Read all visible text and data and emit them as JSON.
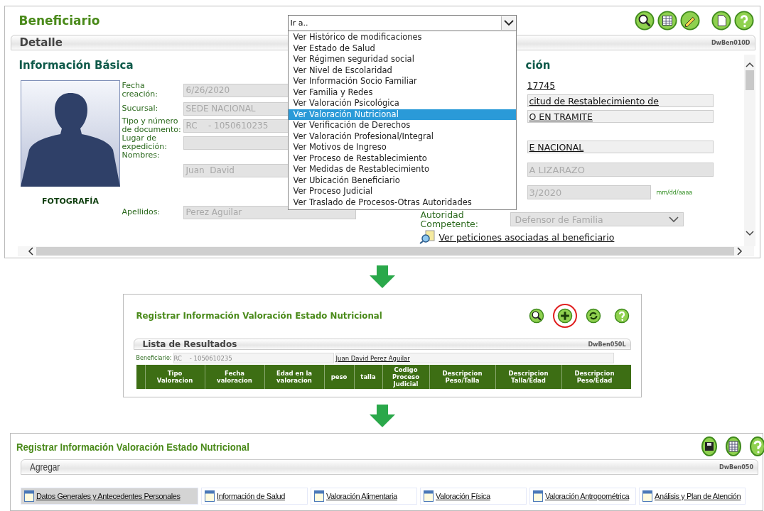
{
  "beneficiary_screen": {
    "title": "Beneficiario",
    "goto_select": {
      "value": "Ir a..",
      "expanded": true,
      "options": [
        {
          "label": "Ver Histórico de modificaciones",
          "selected": false
        },
        {
          "label": "Ver Estado de Salud",
          "selected": false
        },
        {
          "label": "Ver Régimen seguridad social",
          "selected": false
        },
        {
          "label": "Ver Nivel de Escolaridad",
          "selected": false
        },
        {
          "label": "Ver Información Socio Familiar",
          "selected": false
        },
        {
          "label": "Ver Familia y Redes",
          "selected": false
        },
        {
          "label": "Ver Valoración Psicológica",
          "selected": false
        },
        {
          "label": "Ver Valoración Nutricional",
          "selected": true
        },
        {
          "label": "Ver Verificación de Derechos",
          "selected": false
        },
        {
          "label": "Ver Valoración Profesional/Integral",
          "selected": false
        },
        {
          "label": "Ver Motivos de Ingreso",
          "selected": false
        },
        {
          "label": "Ver Proceso de Restablecimiento",
          "selected": false
        },
        {
          "label": "Ver Medidas de Restablecimiento",
          "selected": false
        },
        {
          "label": "Ver Ubicación Beneficiario",
          "selected": false
        },
        {
          "label": "Ver Proceso Judicial",
          "selected": false
        },
        {
          "label": "Ver Traslado de Procesos-Otras Autoridades",
          "selected": false
        }
      ]
    },
    "toolbar": [
      {
        "kind": "search"
      },
      {
        "kind": "table"
      },
      {
        "kind": "edit"
      },
      {
        "kind": "document"
      },
      {
        "kind": "help"
      }
    ],
    "section_title": "Detalle",
    "screen_code": "DwBen010D",
    "basic_heading": "Información Básica",
    "photo_caption": "FOTOGRAFÍA",
    "fields": [
      {
        "label": "Fecha creación:",
        "value": "6/26/2020",
        "disabled": true
      },
      {
        "label": "Sucursal:",
        "value": "SEDE NACIONAL",
        "disabled": true
      },
      {
        "label": "Tipo y número de documento:",
        "value": "RC    - 1050610235",
        "disabled": true
      },
      {
        "label": "Lugar de expedición:",
        "disabled": true
      },
      {
        "label": "Nombres:",
        "value": "Juan  David",
        "disabled": true
      },
      {
        "label": "Apellidos:",
        "value": "Perez Aguilar",
        "disabled": true
      }
    ],
    "right_heading": "ción",
    "right_rows": [
      {
        "kind": "link",
        "text": "17745"
      },
      {
        "kind": "linkfield",
        "text": "citud de Restablecimiento de"
      },
      {
        "kind": "linkfield",
        "text": "O EN TRAMITE"
      },
      {
        "kind": "linkfield",
        "text": "E NACIONAL"
      },
      {
        "kind": "field",
        "text": "A LIZARAZO"
      },
      {
        "kind": "date",
        "text": "3/2020",
        "hint": "mm/dd/aaaa"
      }
    ],
    "authority": {
      "label": "Autoridad Competente:",
      "value": "Defensor de Familia",
      "disabled": true
    },
    "requests_link": "Ver peticiones asociadas al beneficiario"
  },
  "results_screen": {
    "title": "Registrar Información Valoración Estado Nutricional",
    "toolbar": [
      {
        "kind": "search",
        "highlighted": false
      },
      {
        "kind": "add",
        "highlighted": true
      },
      {
        "kind": "refresh",
        "highlighted": false
      },
      {
        "kind": "help",
        "highlighted": false
      }
    ],
    "section_title": "Lista de Resultados",
    "screen_code": "DwBen050L",
    "beneficiary_label": "Beneficiario:",
    "beneficiary_document": "RC    - 1050610235",
    "beneficiary_name": "Juan David Perez Aguilar",
    "columns": [
      "Tipo\nValoracion",
      "Fecha\nvaloracion",
      "Edad en la\nvaloracion",
      "peso",
      "talla",
      "Codigo\nProceso\nJudicial",
      "Descripcion\nPeso/Talla",
      "Descripcion\nTalla/Edad",
      "Descripcion\nPeso/Edad"
    ]
  },
  "add_screen": {
    "title": "Registrar Información Valoración Estado Nutricional",
    "toolbar": [
      {
        "kind": "save"
      },
      {
        "kind": "table"
      },
      {
        "kind": "help"
      }
    ],
    "section_title": "Agregar",
    "screen_code": "DwBen050",
    "tabs": [
      {
        "label": "Datos Generales y Antecedentes Personales",
        "selected": true
      },
      {
        "label": "Información de Salud",
        "selected": false
      },
      {
        "label": "Valoración Alimentaria",
        "selected": false
      },
      {
        "label": "Valoración Física",
        "selected": false
      },
      {
        "label": "Valoración Antropométrica",
        "selected": false
      },
      {
        "label": "Análisis y Plan de Atención",
        "selected": false
      }
    ]
  }
}
